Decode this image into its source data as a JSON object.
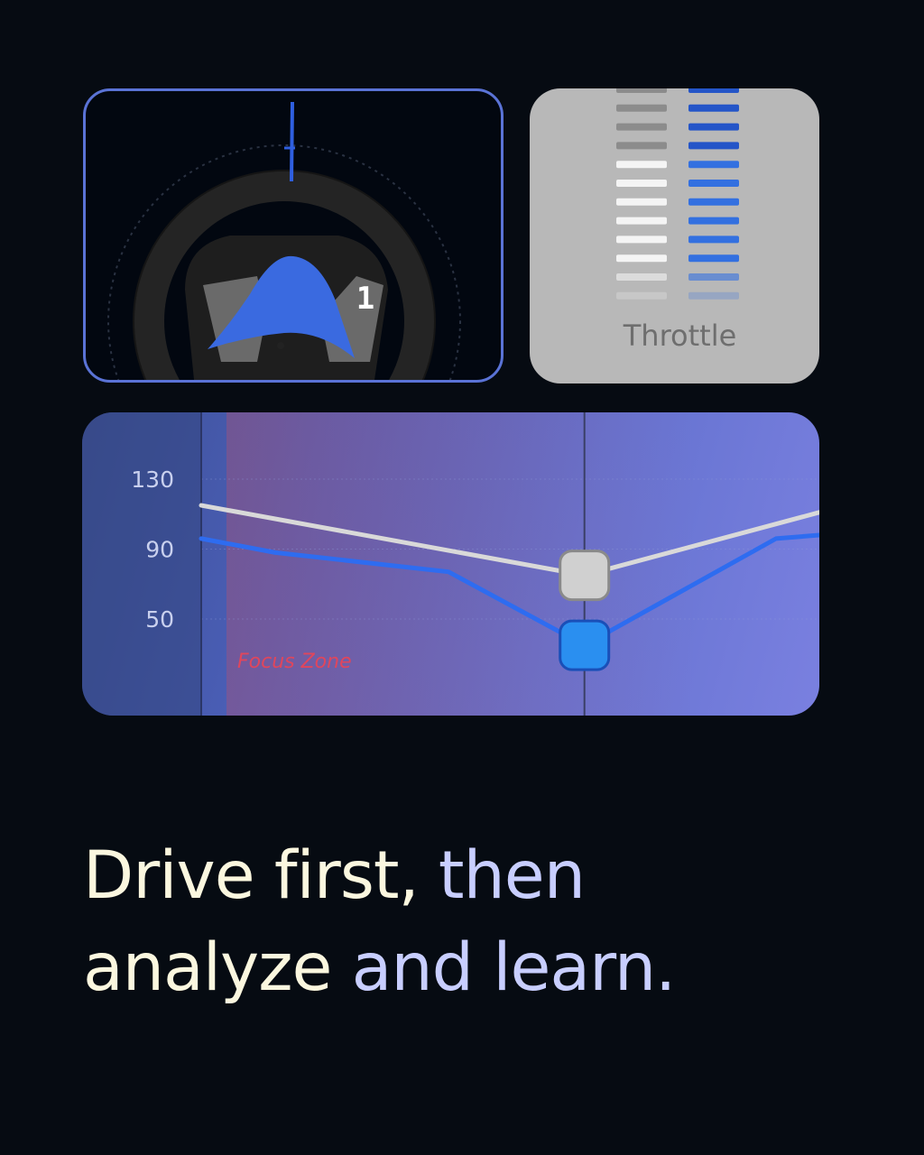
{
  "steering": {
    "gear": "1"
  },
  "throttle": {
    "label": "Throttle"
  },
  "chart_data": {
    "type": "line",
    "yticks": [
      130,
      90,
      50
    ],
    "ylim": [
      20,
      160
    ],
    "xlim": [
      0,
      100
    ],
    "grid": true,
    "annotation": "Focus Zone",
    "series": [
      {
        "color": "#d9d9d9",
        "x": [
          0,
          62,
          100
        ],
        "y": [
          115,
          75,
          111
        ]
      },
      {
        "color": "#2e6cf0",
        "x": [
          0,
          12,
          40,
          62,
          93,
          100
        ],
        "y": [
          96,
          88,
          77,
          35,
          96,
          98
        ]
      }
    ],
    "markers": [
      {
        "x": 62,
        "y": 75,
        "color": "#d0d0d0"
      },
      {
        "x": 62,
        "y": 35,
        "color": "#2a8ff0"
      }
    ],
    "cursor_x": 62
  },
  "headline": {
    "part1": "Drive first, ",
    "part2": "then",
    "part3": "analyze ",
    "part4": "and learn."
  }
}
